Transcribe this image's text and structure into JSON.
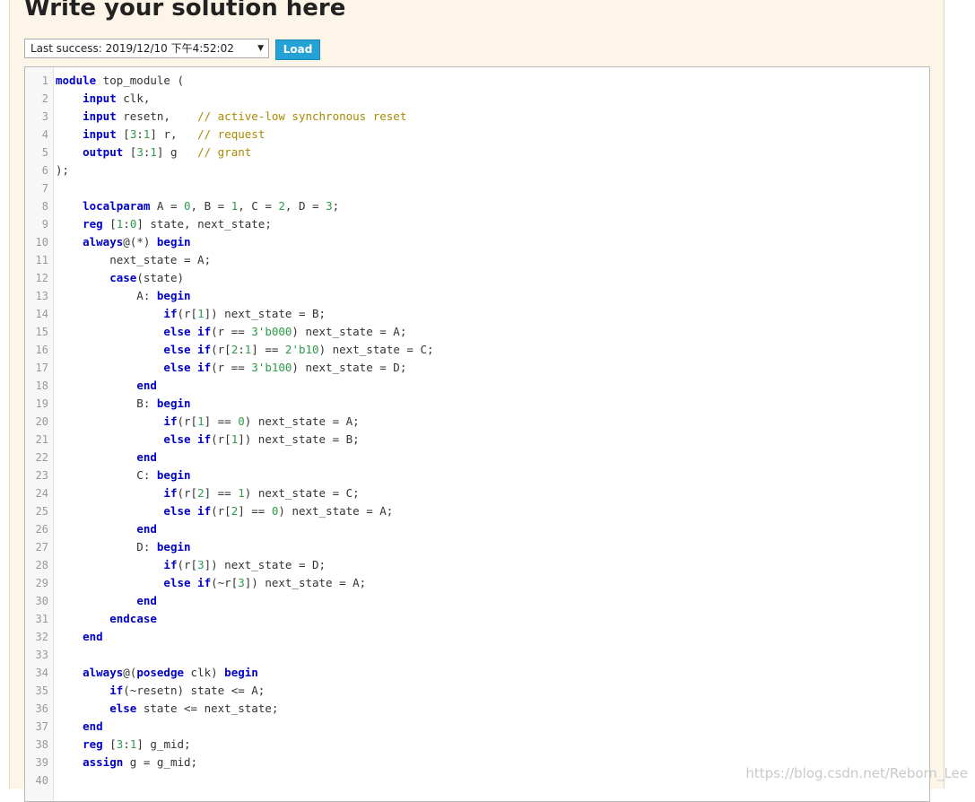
{
  "header": {
    "title": "Write your solution here"
  },
  "toolbar": {
    "select_value": "Last success: 2019/12/10 下午4:52:02",
    "load_label": "Load"
  },
  "editor": {
    "lines": [
      [
        [
          "kw",
          "module"
        ],
        [
          "t",
          " top_module ("
        ]
      ],
      [
        [
          "t",
          "    "
        ],
        [
          "kw",
          "input"
        ],
        [
          "t",
          " clk,"
        ]
      ],
      [
        [
          "t",
          "    "
        ],
        [
          "kw",
          "input"
        ],
        [
          "t",
          " resetn,    "
        ],
        [
          "com",
          "// active-low synchronous reset"
        ]
      ],
      [
        [
          "t",
          "    "
        ],
        [
          "kw",
          "input"
        ],
        [
          "t",
          " ["
        ],
        [
          "num",
          "3"
        ],
        [
          "t",
          ":"
        ],
        [
          "num",
          "1"
        ],
        [
          "t",
          "] r,   "
        ],
        [
          "com",
          "// request"
        ]
      ],
      [
        [
          "t",
          "    "
        ],
        [
          "kw",
          "output"
        ],
        [
          "t",
          " ["
        ],
        [
          "num",
          "3"
        ],
        [
          "t",
          ":"
        ],
        [
          "num",
          "1"
        ],
        [
          "t",
          "] g   "
        ],
        [
          "com",
          "// grant"
        ]
      ],
      [
        [
          "t",
          ");"
        ]
      ],
      [],
      [
        [
          "t",
          "    "
        ],
        [
          "kw",
          "localparam"
        ],
        [
          "t",
          " A = "
        ],
        [
          "num",
          "0"
        ],
        [
          "t",
          ", B = "
        ],
        [
          "num",
          "1"
        ],
        [
          "t",
          ", C = "
        ],
        [
          "num",
          "2"
        ],
        [
          "t",
          ", D = "
        ],
        [
          "num",
          "3"
        ],
        [
          "t",
          ";"
        ]
      ],
      [
        [
          "t",
          "    "
        ],
        [
          "kw",
          "reg"
        ],
        [
          "t",
          " ["
        ],
        [
          "num",
          "1"
        ],
        [
          "t",
          ":"
        ],
        [
          "num",
          "0"
        ],
        [
          "t",
          "] state, next_state;"
        ]
      ],
      [
        [
          "t",
          "    "
        ],
        [
          "kw",
          "always"
        ],
        [
          "t",
          "@(*) "
        ],
        [
          "kw",
          "begin"
        ]
      ],
      [
        [
          "t",
          "        next_state = A;"
        ]
      ],
      [
        [
          "t",
          "        "
        ],
        [
          "kw",
          "case"
        ],
        [
          "t",
          "(state)"
        ]
      ],
      [
        [
          "t",
          "            A: "
        ],
        [
          "kw",
          "begin"
        ]
      ],
      [
        [
          "t",
          "                "
        ],
        [
          "kw",
          "if"
        ],
        [
          "t",
          "(r["
        ],
        [
          "num",
          "1"
        ],
        [
          "t",
          "]) next_state = B;"
        ]
      ],
      [
        [
          "t",
          "                "
        ],
        [
          "kw",
          "else if"
        ],
        [
          "t",
          "(r == "
        ],
        [
          "str",
          "3'b000"
        ],
        [
          "t",
          ") next_state = A;"
        ]
      ],
      [
        [
          "t",
          "                "
        ],
        [
          "kw",
          "else if"
        ],
        [
          "t",
          "(r["
        ],
        [
          "num",
          "2"
        ],
        [
          "t",
          ":"
        ],
        [
          "num",
          "1"
        ],
        [
          "t",
          "] == "
        ],
        [
          "str",
          "2'b10"
        ],
        [
          "t",
          ") next_state = C;"
        ]
      ],
      [
        [
          "t",
          "                "
        ],
        [
          "kw",
          "else if"
        ],
        [
          "t",
          "(r == "
        ],
        [
          "str",
          "3'b100"
        ],
        [
          "t",
          ") next_state = D;"
        ]
      ],
      [
        [
          "t",
          "            "
        ],
        [
          "kw",
          "end"
        ]
      ],
      [
        [
          "t",
          "            B: "
        ],
        [
          "kw",
          "begin"
        ]
      ],
      [
        [
          "t",
          "                "
        ],
        [
          "kw",
          "if"
        ],
        [
          "t",
          "(r["
        ],
        [
          "num",
          "1"
        ],
        [
          "t",
          "] == "
        ],
        [
          "num",
          "0"
        ],
        [
          "t",
          ") next_state = A;"
        ]
      ],
      [
        [
          "t",
          "                "
        ],
        [
          "kw",
          "else if"
        ],
        [
          "t",
          "(r["
        ],
        [
          "num",
          "1"
        ],
        [
          "t",
          "]) next_state = B;"
        ]
      ],
      [
        [
          "t",
          "            "
        ],
        [
          "kw",
          "end"
        ]
      ],
      [
        [
          "t",
          "            C: "
        ],
        [
          "kw",
          "begin"
        ]
      ],
      [
        [
          "t",
          "                "
        ],
        [
          "kw",
          "if"
        ],
        [
          "t",
          "(r["
        ],
        [
          "num",
          "2"
        ],
        [
          "t",
          "] == "
        ],
        [
          "num",
          "1"
        ],
        [
          "t",
          ") next_state = C;"
        ]
      ],
      [
        [
          "t",
          "                "
        ],
        [
          "kw",
          "else if"
        ],
        [
          "t",
          "(r["
        ],
        [
          "num",
          "2"
        ],
        [
          "t",
          "] == "
        ],
        [
          "num",
          "0"
        ],
        [
          "t",
          ") next_state = A;"
        ]
      ],
      [
        [
          "t",
          "            "
        ],
        [
          "kw",
          "end"
        ]
      ],
      [
        [
          "t",
          "            D: "
        ],
        [
          "kw",
          "begin"
        ]
      ],
      [
        [
          "t",
          "                "
        ],
        [
          "kw",
          "if"
        ],
        [
          "t",
          "(r["
        ],
        [
          "num",
          "3"
        ],
        [
          "t",
          "]) next_state = D;"
        ]
      ],
      [
        [
          "t",
          "                "
        ],
        [
          "kw",
          "else if"
        ],
        [
          "t",
          "(~r["
        ],
        [
          "num",
          "3"
        ],
        [
          "t",
          "]) next_state = A;"
        ]
      ],
      [
        [
          "t",
          "            "
        ],
        [
          "kw",
          "end"
        ]
      ],
      [
        [
          "t",
          "        "
        ],
        [
          "kw",
          "endcase"
        ]
      ],
      [
        [
          "t",
          "    "
        ],
        [
          "kw",
          "end"
        ]
      ],
      [],
      [
        [
          "t",
          "    "
        ],
        [
          "kw",
          "always"
        ],
        [
          "t",
          "@("
        ],
        [
          "kw",
          "posedge"
        ],
        [
          "t",
          " clk) "
        ],
        [
          "kw",
          "begin"
        ]
      ],
      [
        [
          "t",
          "        "
        ],
        [
          "kw",
          "if"
        ],
        [
          "t",
          "(~resetn) state <= A;"
        ]
      ],
      [
        [
          "t",
          "        "
        ],
        [
          "kw",
          "else"
        ],
        [
          "t",
          " state <= next_state;"
        ]
      ],
      [
        [
          "t",
          "    "
        ],
        [
          "kw",
          "end"
        ]
      ],
      [
        [
          "t",
          "    "
        ],
        [
          "kw",
          "reg"
        ],
        [
          "t",
          " ["
        ],
        [
          "num",
          "3"
        ],
        [
          "t",
          ":"
        ],
        [
          "num",
          "1"
        ],
        [
          "t",
          "] g_mid;"
        ]
      ],
      [
        [
          "t",
          "    "
        ],
        [
          "kw",
          "assign"
        ],
        [
          "t",
          " g = g_mid;"
        ]
      ],
      []
    ]
  },
  "watermark": "https://blog.csdn.net/Reborn_Lee",
  "colors": {
    "panel_bg": "#fdf6e8",
    "keyword": "#0000cc",
    "number": "#2e9b4a",
    "comment": "#aa8800",
    "load_button": "#24a2d6"
  }
}
